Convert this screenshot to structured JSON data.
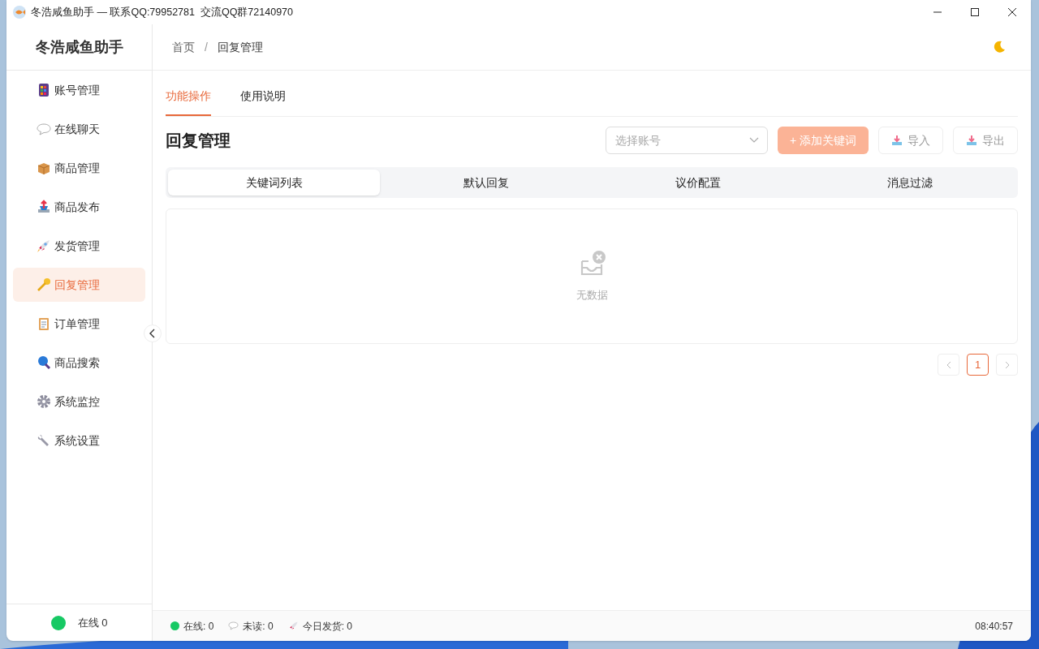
{
  "window": {
    "title": "冬浩咸鱼助手 — 联系QQ:79952781  交流QQ群72140970"
  },
  "app_name": "冬浩咸鱼助手",
  "breadcrumb": [
    "首页",
    "回复管理"
  ],
  "breadcrumb_separator": "/",
  "menu": [
    {
      "label": "账号管理",
      "selected": false
    },
    {
      "label": "在线聊天",
      "selected": false
    },
    {
      "label": "商品管理",
      "selected": false
    },
    {
      "label": "商品发布",
      "selected": false
    },
    {
      "label": "发货管理",
      "selected": false
    },
    {
      "label": "回复管理",
      "selected": true
    },
    {
      "label": "订单管理",
      "selected": false
    },
    {
      "label": "商品搜索",
      "selected": false
    },
    {
      "label": "系统监控",
      "selected": false
    },
    {
      "label": "系统设置",
      "selected": false
    }
  ],
  "sidebar_status": {
    "label": "在线 0",
    "color": "#17c964"
  },
  "tabs": [
    {
      "label": "功能操作",
      "selected": true
    },
    {
      "label": "使用说明",
      "selected": false
    }
  ],
  "page_title": "回复管理",
  "account_select": {
    "placeholder": "选择账号"
  },
  "buttons": [
    {
      "label": "+ 添加关键词",
      "kind": "primary",
      "disabled": true
    },
    {
      "label": "导入",
      "kind": "import",
      "disabled": true
    },
    {
      "label": "导出",
      "kind": "export",
      "disabled": true
    }
  ],
  "subtabs": [
    {
      "label": "关键词列表",
      "selected": true
    },
    {
      "label": "默认回复",
      "selected": false
    },
    {
      "label": "议价配置",
      "selected": false
    },
    {
      "label": "消息过滤",
      "selected": false
    }
  ],
  "empty_text": "无数据",
  "pagination": [
    {
      "label": "1",
      "selected": true
    }
  ],
  "status_bar": [
    {
      "kind": "online",
      "label": "在线: 0",
      "color": "#17c964"
    },
    {
      "kind": "unread",
      "label": "未读: 0"
    },
    {
      "kind": "shipped",
      "label": "今日发货: 0"
    }
  ],
  "time": "08:40:57"
}
